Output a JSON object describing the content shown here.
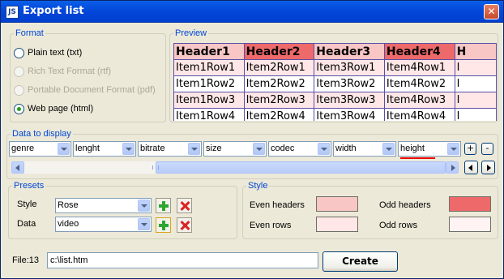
{
  "window": {
    "title": "Export list",
    "app_icon_text": "JS",
    "close_glyph": "✕"
  },
  "format": {
    "legend": "Format",
    "options": [
      {
        "label": "Plain text (txt)",
        "checked": false,
        "disabled": false
      },
      {
        "label": "Rich Text Format (rtf)",
        "checked": false,
        "disabled": true
      },
      {
        "label": "Portable Document Format (pdf)",
        "checked": false,
        "disabled": true
      },
      {
        "label": "Web page (html)",
        "checked": true,
        "disabled": false
      }
    ]
  },
  "preview": {
    "legend": "Preview",
    "headers": [
      "Header1",
      "Header2",
      "Header3",
      "Header4",
      "H"
    ],
    "header_colors": [
      "#F9C6C6",
      "#EE6A6A",
      "#F9C6C6",
      "#EE6A6A",
      "#F9C6C6"
    ],
    "rows": [
      [
        "Item1Row1",
        "Item2Row1",
        "Item3Row1",
        "Item4Row1",
        "I"
      ],
      [
        "Item1Row2",
        "Item2Row2",
        "Item3Row2",
        "Item4Row2",
        "I"
      ],
      [
        "Item1Row3",
        "Item2Row3",
        "Item3Row3",
        "Item4Row3",
        "I"
      ],
      [
        "Item1Row4",
        "Item2Row4",
        "Item3Row4",
        "Item4Row4",
        "I"
      ]
    ],
    "row_colors": [
      "#FFE7E7",
      "#FFFFFF",
      "#FFE7E7",
      "#FFFFFF"
    ]
  },
  "data_to_display": {
    "legend": "Data to display",
    "columns": [
      "genre",
      "lenght",
      "bitrate",
      "size",
      "codec",
      "width",
      "height"
    ],
    "add_label": "+",
    "remove_label": "-",
    "scroll_grip": "III"
  },
  "presets": {
    "legend": "Presets",
    "style_label": "Style",
    "style_value": "Rose",
    "data_label": "Data",
    "data_value": "video"
  },
  "style": {
    "legend": "Style",
    "even_headers_label": "Even headers",
    "odd_headers_label": "Odd headers",
    "even_rows_label": "Even rows",
    "odd_rows_label": "Odd rows",
    "even_headers_color": "#F9C6C6",
    "odd_headers_color": "#EE6A6A",
    "even_rows_color": "#FFE7E7",
    "odd_rows_color": "#FFF3F3"
  },
  "file": {
    "label": "File:13",
    "value": "c:\\list.htm",
    "create_label": "Create"
  }
}
